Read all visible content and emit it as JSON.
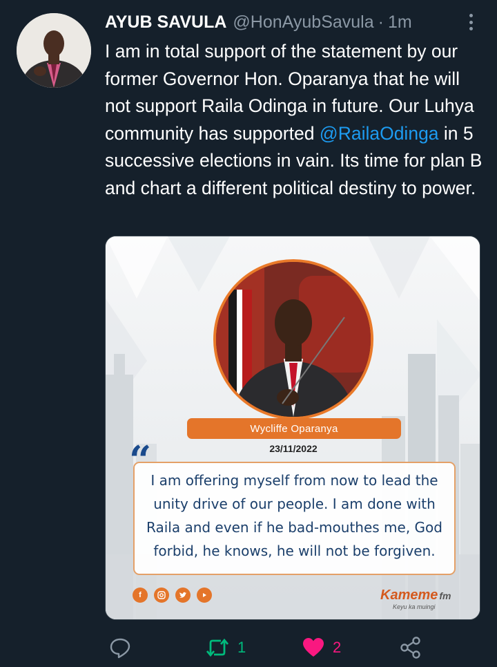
{
  "tweet": {
    "author_name": "AYUB SAVULA",
    "handle": "@HonAyubSavula",
    "separator": "·",
    "time": "1m",
    "text_before_mention": "I am in total support of the statement by our former Governor Hon. Oparanya that he will not support Raila Odinga in future. Our Luhya community has supported ",
    "mention": "@RailaOdinga",
    "text_after_mention": " in 5 successive elections in vain. Its time for plan B and chart a different political destiny to power."
  },
  "media": {
    "person_name": "Wycliffe Oparanya",
    "date": "23/11/2022",
    "quote": "I am offering myself from now to lead the unity drive of our people. I am done with Raila and even if he bad-mouthes me, God forbid, he knows, he will not be forgiven.",
    "brand_name": "Kameme",
    "brand_suffix": "fm",
    "brand_tagline": "Keyu ka muingi",
    "social_icons": [
      "facebook-icon",
      "instagram-icon",
      "twitter-icon",
      "youtube-icon"
    ]
  },
  "actions": {
    "reply_icon": "reply-icon",
    "retweet_icon": "retweet-icon",
    "retweet_count": "1",
    "like_icon": "heart-icon",
    "like_count": "2",
    "share_icon": "share-icon"
  },
  "colors": {
    "background": "#15202b",
    "mention": "#1d9bf0",
    "retweet_active": "#00ba7c",
    "like_active": "#f91880",
    "muted": "#8b98a5",
    "accent_orange": "#e4752a"
  }
}
